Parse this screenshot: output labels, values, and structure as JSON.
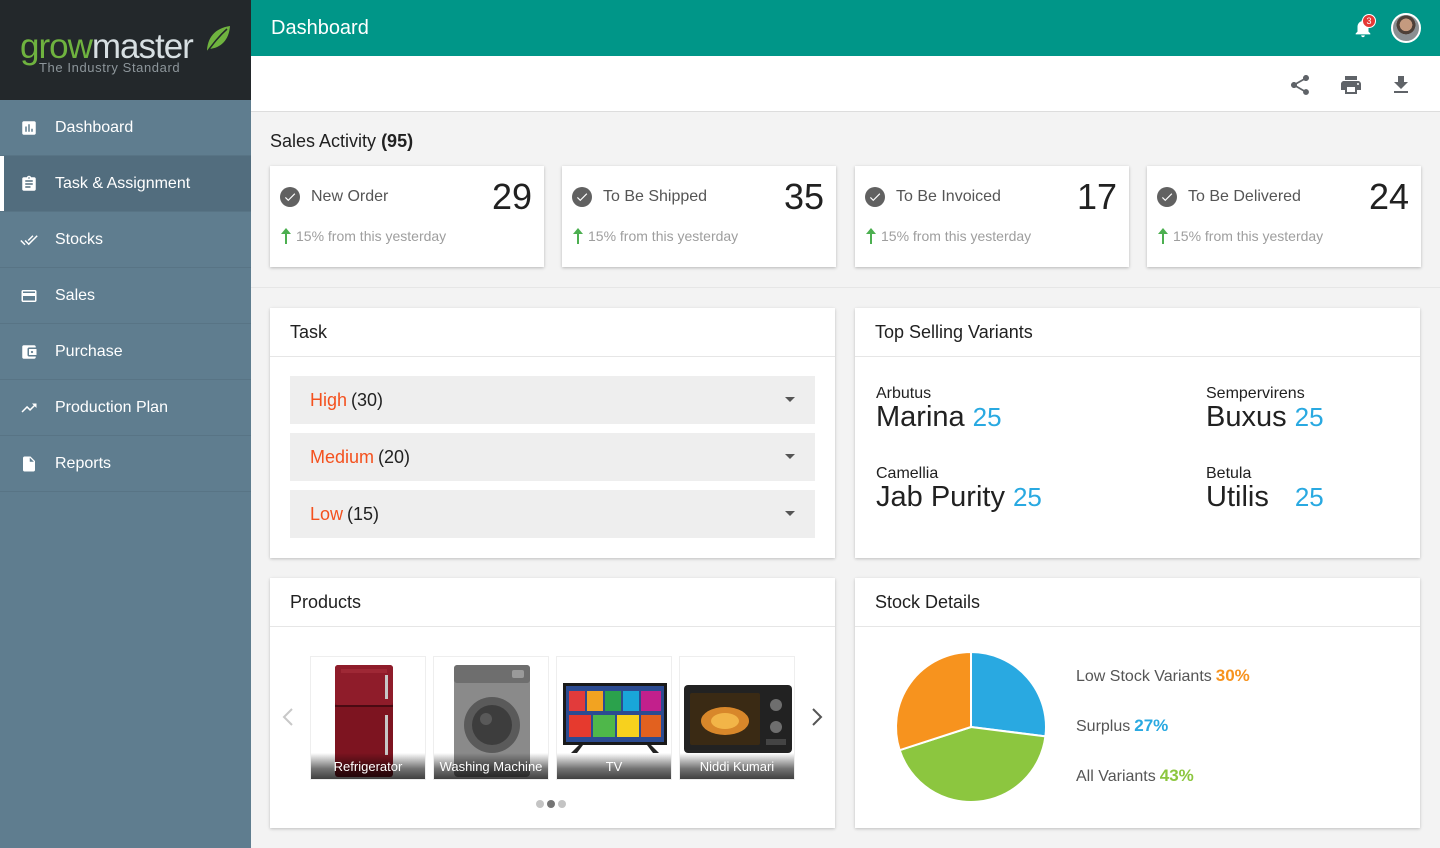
{
  "brand": {
    "name_part1": "grow",
    "name_part2": "master",
    "tagline": "The Industry Standard"
  },
  "sidebar": {
    "items": [
      {
        "label": "Dashboard",
        "icon": "bar-chart-icon"
      },
      {
        "label": "Task & Assignment",
        "icon": "clipboard-icon"
      },
      {
        "label": "Stocks",
        "icon": "double-check-icon"
      },
      {
        "label": "Sales",
        "icon": "credit-card-icon"
      },
      {
        "label": "Purchase",
        "icon": "wallet-icon"
      },
      {
        "label": "Production Plan",
        "icon": "trending-up-icon"
      },
      {
        "label": "Reports",
        "icon": "document-icon"
      }
    ],
    "active_index": 1
  },
  "header": {
    "title": "Dashboard",
    "notification_count": "3"
  },
  "sales": {
    "title": "Sales Activity",
    "total": "(95)",
    "cards": [
      {
        "label": "New Order",
        "value": "29",
        "trend": "15% from this yesterday"
      },
      {
        "label": "To Be Shipped",
        "value": "35",
        "trend": "15% from this yesterday"
      },
      {
        "label": "To Be Invoiced",
        "value": "17",
        "trend": "15% from this yesterday"
      },
      {
        "label": "To Be Delivered",
        "value": "24",
        "trend": "15% from this yesterday"
      }
    ]
  },
  "task": {
    "title": "Task",
    "rows": [
      {
        "level": "High",
        "count": "(30)"
      },
      {
        "level": "Medium",
        "count": "(20)"
      },
      {
        "level": "Low",
        "count": "(15)"
      }
    ]
  },
  "top_selling": {
    "title": "Top Selling Variants",
    "items": [
      {
        "sub": "Arbutus",
        "main": "Marina",
        "count": "25"
      },
      {
        "sub": "Sempervirens",
        "main": "Buxus",
        "count": "25"
      },
      {
        "sub": "Camellia",
        "main": "Jab Purity",
        "count": "25"
      },
      {
        "sub": "Betula",
        "main": "Utilis",
        "count": "25"
      }
    ]
  },
  "products": {
    "title": "Products",
    "items": [
      {
        "caption": "Refrigerator"
      },
      {
        "caption": "Washing Machine"
      },
      {
        "caption": "TV"
      },
      {
        "caption": "Niddi Kumari"
      }
    ],
    "page_count": 3,
    "active_page": 1
  },
  "stock": {
    "title": "Stock Details",
    "legend": [
      {
        "label": "Low Stock Variants",
        "pct": "30%",
        "color": "#f7931e"
      },
      {
        "label": "Surplus",
        "pct": "27%",
        "color": "#29a9e1"
      },
      {
        "label": "All Variants",
        "pct": "43%",
        "color": "#8cc63f"
      }
    ]
  },
  "chart_data": {
    "type": "pie",
    "categories": [
      "Low Stock Variants",
      "Surplus",
      "All Variants"
    ],
    "values": [
      30,
      27,
      43
    ],
    "colors": [
      "#f7931e",
      "#29a9e1",
      "#8cc63f"
    ]
  }
}
